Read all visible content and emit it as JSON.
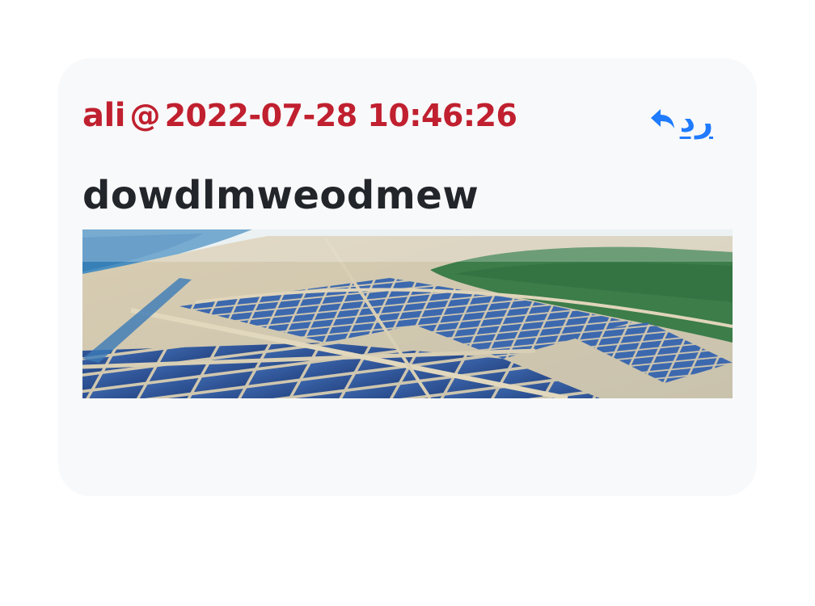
{
  "comment": {
    "author": "ali",
    "separator": "@",
    "timestamp": "2022-07-28 10:46:26",
    "reply_label": "رد",
    "body": "dowdlmweodmew",
    "image_alt": "aerial view of solar panel field"
  },
  "icons": {
    "reply": "reply-arrow-icon"
  },
  "colors": {
    "author": "#c0202f",
    "link": "#1f7bff",
    "text": "#222529",
    "card_background": "#f8f9fa"
  }
}
